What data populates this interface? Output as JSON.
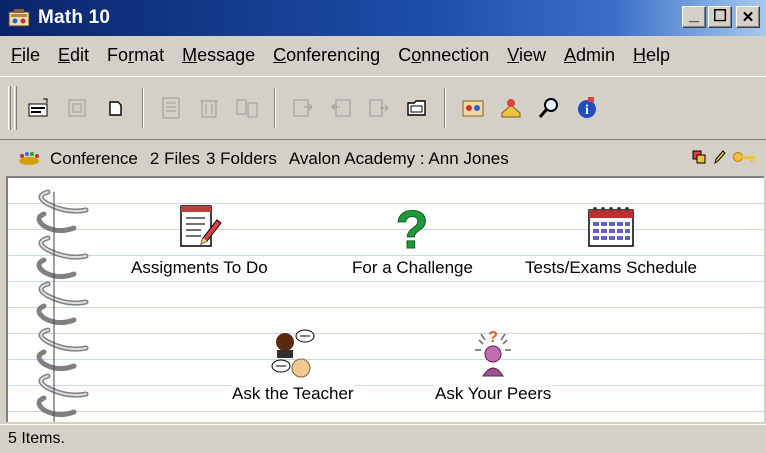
{
  "window": {
    "title": "Math 10",
    "buttons": {
      "minimize": "_",
      "maximize": "☐",
      "close": "✕"
    }
  },
  "menu": {
    "items": [
      {
        "pre": "",
        "accel": "F",
        "post": "ile"
      },
      {
        "pre": "",
        "accel": "E",
        "post": "dit"
      },
      {
        "pre": "Fo",
        "accel": "r",
        "post": "mat"
      },
      {
        "pre": "",
        "accel": "M",
        "post": "essage"
      },
      {
        "pre": "",
        "accel": "C",
        "post": "onferencing"
      },
      {
        "pre": "C",
        "accel": "o",
        "post": "nnection"
      },
      {
        "pre": "",
        "accel": "V",
        "post": "iew"
      },
      {
        "pre": "",
        "accel": "A",
        "post": "dmin"
      },
      {
        "pre": "",
        "accel": "H",
        "post": "elp"
      }
    ]
  },
  "toolbar": {
    "icons": [
      "new-message-icon",
      "reply-icon",
      "new-item-icon",
      "open-icon",
      "delete-icon",
      "copy-icon",
      "forward-icon",
      "reply-all-icon",
      "next-icon",
      "folder-icon",
      "people-icon",
      "chat-icon",
      "search-icon",
      "info-icon"
    ]
  },
  "infobar": {
    "type": "Conference",
    "files": "2 Files",
    "folders": "3 Folders",
    "location": "Avalon Academy : Ann Jones"
  },
  "items": [
    {
      "label": "Assigments To Do",
      "icon": "checklist-icon"
    },
    {
      "label": "For a Challenge",
      "icon": "question-mark-icon"
    },
    {
      "label": "Tests/Exams Schedule",
      "icon": "calendar-icon"
    },
    {
      "label": "Ask the Teacher",
      "icon": "chat-people-icon"
    },
    {
      "label": "Ask Your Peers",
      "icon": "peer-question-icon"
    }
  ],
  "status": {
    "text": "5 Items."
  }
}
